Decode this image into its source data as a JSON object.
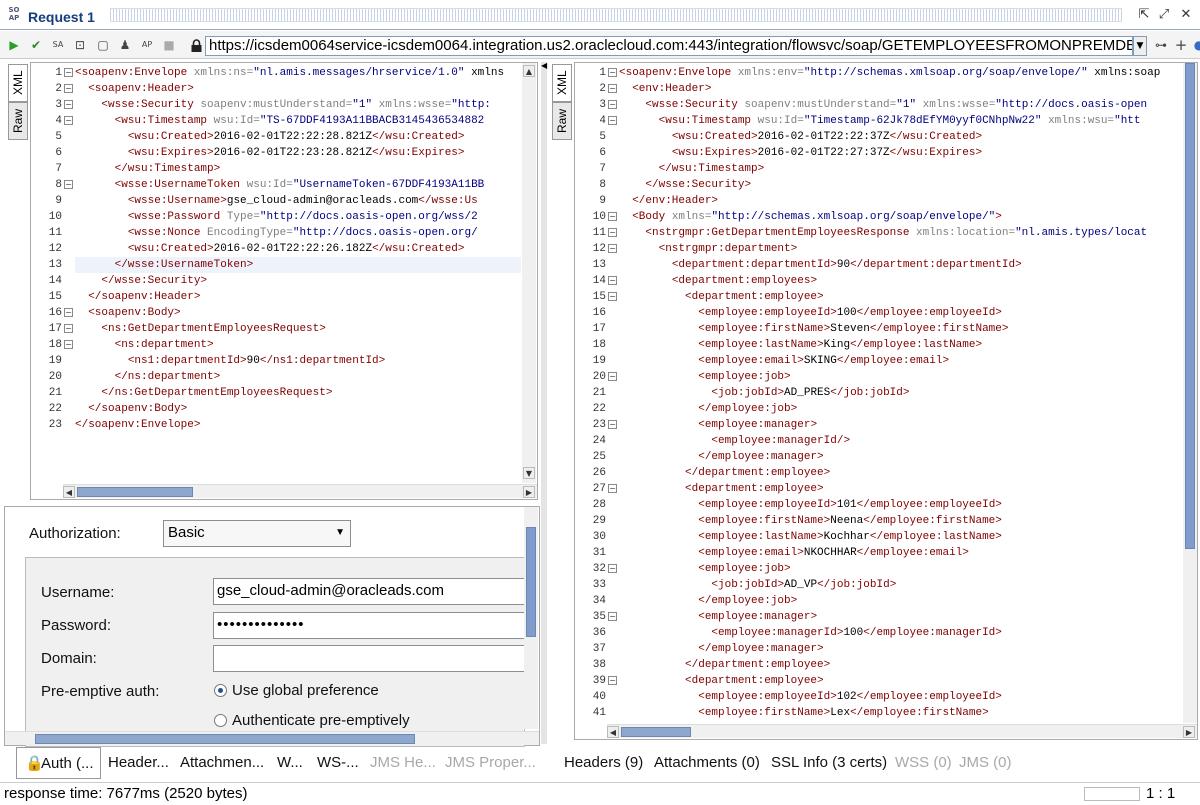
{
  "window": {
    "title": "Request 1",
    "logo_text": "SO AP"
  },
  "toolbar": {
    "url": "https://icsdem0064service-icsdem0064.integration.us2.oraclecloud.com:443/integration/flowsvc/soap/GETEMPLOYEESFROMONPREMDB/v0"
  },
  "request": {
    "tabs": [
      "XML",
      "Raw"
    ],
    "lines": [
      "<soapenv:Envelope xmlns:ns=\"nl.amis.messages/hrservice/1.0\" xmlns",
      "  <soapenv:Header>",
      "    <wsse:Security soapenv:mustUnderstand=\"1\" xmlns:wsse=\"http:",
      "      <wsu:Timestamp wsu:Id=\"TS-67DDF4193A11BBACB3145436534882",
      "        <wsu:Created>2016-02-01T22:22:28.821Z</wsu:Created>",
      "        <wsu:Expires>2016-02-01T22:23:28.821Z</wsu:Expires>",
      "      </wsu:Timestamp>",
      "      <wsse:UsernameToken wsu:Id=\"UsernameToken-67DDF4193A11BB",
      "        <wsse:Username>gse_cloud-admin@oracleads.com</wsse:Us",
      "        <wsse:Password Type=\"http://docs.oasis-open.org/wss/2",
      "        <wsse:Nonce EncodingType=\"http://docs.oasis-open.org/",
      "        <wsu:Created>2016-02-01T22:22:26.182Z</wsu:Created>",
      "      </wsse:UsernameToken>",
      "    </wsse:Security>",
      "  </soapenv:Header>",
      "  <soapenv:Body>",
      "    <ns:GetDepartmentEmployeesRequest>",
      "      <ns:department>",
      "        <ns1:departmentId>90</ns1:departmentId>",
      "      </ns:department>",
      "    </ns:GetDepartmentEmployeesRequest>",
      "  </soapenv:Body>",
      "</soapenv:Envelope>"
    ],
    "fold_lines": [
      1,
      2,
      3,
      4,
      8,
      16,
      17,
      18
    ]
  },
  "auth": {
    "authorization_label": "Authorization:",
    "authorization_value": "Basic",
    "username_label": "Username:",
    "username_value": "gse_cloud-admin@oracleads.com",
    "password_label": "Password:",
    "password_value": "••••••••••••••",
    "domain_label": "Domain:",
    "domain_value": "",
    "preemptive_label": "Pre-emptive auth:",
    "option_global": "Use global preference",
    "option_preemptive": "Authenticate pre-emptively"
  },
  "request_tabs": [
    "Auth (...",
    "Header...",
    "Attachmen...",
    "W...",
    "WS-...",
    "JMS He...",
    "JMS Proper..."
  ],
  "response": {
    "tabs": [
      "XML",
      "Raw"
    ],
    "lines": [
      "<soapenv:Envelope xmlns:env=\"http://schemas.xmlsoap.org/soap/envelope/\" xmlns:soap",
      "  <env:Header>",
      "    <wsse:Security soapenv:mustUnderstand=\"1\" xmlns:wsse=\"http://docs.oasis-open",
      "      <wsu:Timestamp wsu:Id=\"Timestamp-62Jk78dEfYM0yyf0CNhpNw22\" xmlns:wsu=\"htt",
      "        <wsu:Created>2016-02-01T22:22:37Z</wsu:Created>",
      "        <wsu:Expires>2016-02-01T22:27:37Z</wsu:Expires>",
      "      </wsu:Timestamp>",
      "    </wsse:Security>",
      "  </env:Header>",
      "  <Body xmlns=\"http://schemas.xmlsoap.org/soap/envelope/\">",
      "    <nstrgmpr:GetDepartmentEmployeesResponse xmlns:location=\"nl.amis.types/locat",
      "      <nstrgmpr:department>",
      "        <department:departmentId>90</department:departmentId>",
      "        <department:employees>",
      "          <department:employee>",
      "            <employee:employeeId>100</employee:employeeId>",
      "            <employee:firstName>Steven</employee:firstName>",
      "            <employee:lastName>King</employee:lastName>",
      "            <employee:email>SKING</employee:email>",
      "            <employee:job>",
      "              <job:jobId>AD_PRES</job:jobId>",
      "            </employee:job>",
      "            <employee:manager>",
      "              <employee:managerId/>",
      "            </employee:manager>",
      "          </department:employee>",
      "          <department:employee>",
      "            <employee:employeeId>101</employee:employeeId>",
      "            <employee:firstName>Neena</employee:firstName>",
      "            <employee:lastName>Kochhar</employee:lastName>",
      "            <employee:email>NKOCHHAR</employee:email>",
      "            <employee:job>",
      "              <job:jobId>AD_VP</job:jobId>",
      "            </employee:job>",
      "            <employee:manager>",
      "              <employee:managerId>100</employee:managerId>",
      "            </employee:manager>",
      "          </department:employee>",
      "          <department:employee>",
      "            <employee:employeeId>102</employee:employeeId>",
      "            <employee:firstName>Lex</employee:firstName>"
    ],
    "fold_lines": [
      1,
      2,
      3,
      4,
      10,
      11,
      12,
      14,
      15,
      20,
      23,
      27,
      32,
      35,
      39
    ]
  },
  "response_tabs": [
    {
      "label": "Headers (9)",
      "enabled": true
    },
    {
      "label": "Attachments (0)",
      "enabled": true
    },
    {
      "label": "SSL Info (3 certs)",
      "enabled": true
    },
    {
      "label": "WSS (0)",
      "enabled": false
    },
    {
      "label": "JMS (0)",
      "enabled": false
    }
  ],
  "status": {
    "response_time": "response time: 7677ms (2520 bytes)",
    "position": "1 : 1"
  },
  "colors": {
    "tag": "#800000",
    "attr": "#7f7f7f",
    "value": "#000080",
    "accent": "#163e7a"
  }
}
